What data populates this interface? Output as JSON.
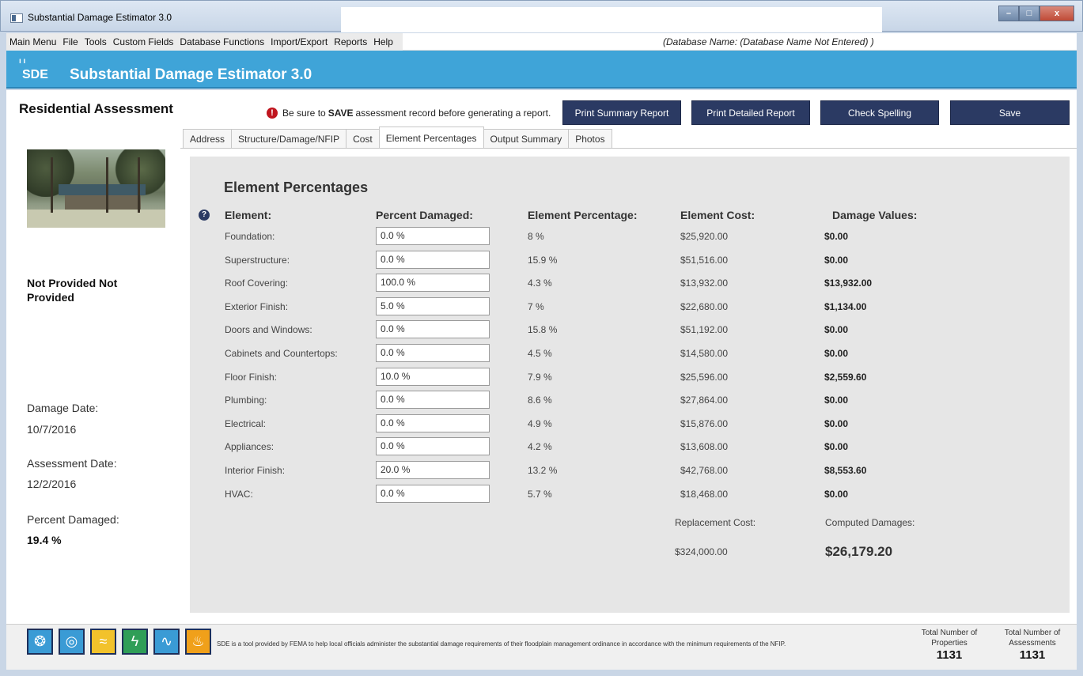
{
  "window": {
    "title": "Substantial Damage Estimator 3.0",
    "controls": {
      "minimize": "–",
      "maximize": "□",
      "close": "x"
    }
  },
  "menu": {
    "items": [
      "Main Menu",
      "File",
      "Tools",
      "Custom Fields",
      "Database Functions",
      "Import/Export",
      "Reports",
      "Help"
    ],
    "database_name": "(Database Name:  (Database Name Not Entered) )"
  },
  "banner": {
    "logo_text": "SDE",
    "logo_bars": "ı ı",
    "title": "Substantial Damage Estimator 3.0"
  },
  "header": {
    "title": "Residential Assessment",
    "notice_pre": "Be sure to",
    "notice_bold": "SAVE",
    "notice_post": "assessment record before generating a report.",
    "buttons": {
      "print_summary": "Print Summary Report",
      "print_detailed": "Print Detailed Report",
      "check_spelling": "Check Spelling",
      "save": "Save"
    }
  },
  "tabs": [
    {
      "label": "Address"
    },
    {
      "label": "Structure/Damage/NFIP"
    },
    {
      "label": "Cost"
    },
    {
      "label": "Element Percentages",
      "active": true
    },
    {
      "label": "Output Summary"
    },
    {
      "label": "Photos"
    }
  ],
  "sidebar": {
    "owner": "Not Provided Not Provided",
    "damage_date_label": "Damage Date:",
    "damage_date": "10/7/2016",
    "assessment_date_label": "Assessment Date:",
    "assessment_date": "12/2/2016",
    "percent_damaged_label": "Percent Damaged:",
    "percent_damaged": "19.4 %"
  },
  "element_percentages": {
    "title": "Element Percentages",
    "headers": {
      "element": "Element:",
      "percent_damaged": "Percent Damaged:",
      "element_percentage": "Element Percentage:",
      "element_cost": "Element Cost:",
      "damage_values": "Damage Values:"
    },
    "rows": [
      {
        "element": "Foundation:",
        "percent_damaged": "0.0 %",
        "element_percentage": "8 %",
        "element_cost": "$25,920.00",
        "damage_value": "$0.00"
      },
      {
        "element": "Superstructure:",
        "percent_damaged": "0.0 %",
        "element_percentage": "15.9 %",
        "element_cost": "$51,516.00",
        "damage_value": "$0.00"
      },
      {
        "element": "Roof Covering:",
        "percent_damaged": "100.0 %",
        "element_percentage": "4.3 %",
        "element_cost": "$13,932.00",
        "damage_value": "$13,932.00"
      },
      {
        "element": "Exterior Finish:",
        "percent_damaged": "5.0 %",
        "element_percentage": "7 %",
        "element_cost": "$22,680.00",
        "damage_value": "$1,134.00"
      },
      {
        "element": "Doors and Windows:",
        "percent_damaged": "0.0 %",
        "element_percentage": "15.8 %",
        "element_cost": "$51,192.00",
        "damage_value": "$0.00"
      },
      {
        "element": "Cabinets and Countertops:",
        "percent_damaged": "0.0 %",
        "element_percentage": "4.5 %",
        "element_cost": "$14,580.00",
        "damage_value": "$0.00"
      },
      {
        "element": "Floor Finish:",
        "percent_damaged": "10.0 %",
        "element_percentage": "7.9 %",
        "element_cost": "$25,596.00",
        "damage_value": "$2,559.60"
      },
      {
        "element": "Plumbing:",
        "percent_damaged": "0.0 %",
        "element_percentage": "8.6 %",
        "element_cost": "$27,864.00",
        "damage_value": "$0.00"
      },
      {
        "element": "Electrical:",
        "percent_damaged": "0.0 %",
        "element_percentage": "4.9 %",
        "element_cost": "$15,876.00",
        "damage_value": "$0.00"
      },
      {
        "element": "Appliances:",
        "percent_damaged": "0.0 %",
        "element_percentage": "4.2 %",
        "element_cost": "$13,608.00",
        "damage_value": "$0.00"
      },
      {
        "element": "Interior Finish:",
        "percent_damaged": "20.0 %",
        "element_percentage": "13.2 %",
        "element_cost": "$42,768.00",
        "damage_value": "$8,553.60"
      },
      {
        "element": "HVAC:",
        "percent_damaged": "0.0 %",
        "element_percentage": "5.7 %",
        "element_cost": "$18,468.00",
        "damage_value": "$0.00"
      }
    ],
    "replacement_cost_label": "Replacement Cost:",
    "replacement_cost": "$324,000.00",
    "computed_damages_label": "Computed Damages:",
    "computed_damages": "$26,179.20"
  },
  "footer": {
    "hazard_icons": [
      {
        "name": "tornado-icon",
        "glyph": "❂",
        "bg": "#3a9bd5"
      },
      {
        "name": "hurricane-icon",
        "glyph": "◎",
        "bg": "#3a9bd5"
      },
      {
        "name": "flood-icon",
        "glyph": "≈",
        "bg": "#f2c22b"
      },
      {
        "name": "earthquake-icon",
        "glyph": "ϟ",
        "bg": "#2f9e57"
      },
      {
        "name": "tsunami-icon",
        "glyph": "∿",
        "bg": "#3a9bd5"
      },
      {
        "name": "wildfire-icon",
        "glyph": "♨",
        "bg": "#f0a01a"
      }
    ],
    "note": "SDE is a tool provided by FEMA to help local officials administer the substantial damage requirements of their floodplain management ordinance in accordance with the minimum requirements of the NFIP.",
    "total_properties_label": "Total Number of Properties",
    "total_properties": "1131",
    "total_assessments_label": "Total Number of Assessments",
    "total_assessments": "1131"
  },
  "colors": {
    "banner": "#3fa4d8",
    "button": "#2b3a63",
    "warning": "#c0151e",
    "content_bg": "#e6e6e6"
  }
}
